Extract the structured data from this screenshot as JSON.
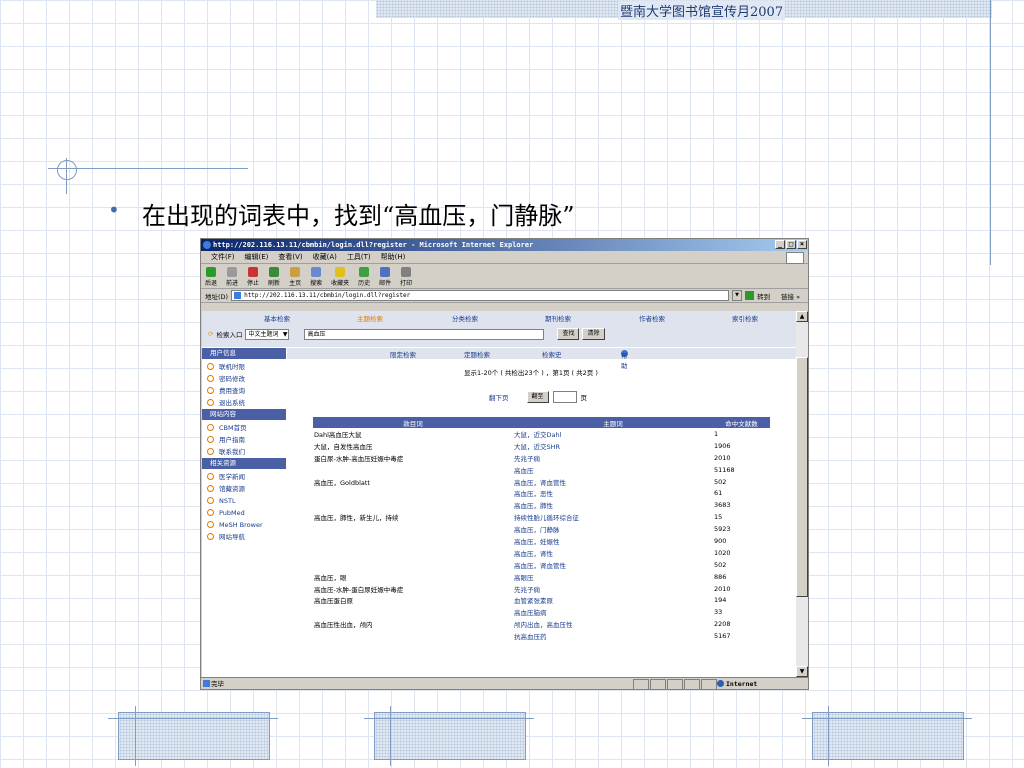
{
  "slide": {
    "header": "暨南大学图书馆宣传月2007",
    "bullet": "•",
    "heading": "在出现的词表中，找到“高血压，门静脉”"
  },
  "browser": {
    "title": "http://202.116.13.11/cbmbin/login.dll?register - Microsoft Internet Explorer",
    "controls": [
      "_",
      "□",
      "×"
    ],
    "menu": [
      "文件(F)",
      "编辑(E)",
      "查看(V)",
      "收藏(A)",
      "工具(T)",
      "帮助(H)"
    ],
    "toolbar": [
      {
        "label": "后退",
        "icon": "back-icon",
        "color": "#2a9a2a"
      },
      {
        "label": "前进",
        "icon": "forward-icon",
        "color": "#9a9a9a"
      },
      {
        "label": "停止",
        "icon": "stop-icon",
        "color": "#c83232"
      },
      {
        "label": "刷新",
        "icon": "refresh-icon",
        "color": "#3a8a3a"
      },
      {
        "label": "主页",
        "icon": "home-icon",
        "color": "#c8a040"
      },
      {
        "label": "搜索",
        "icon": "search-icon",
        "color": "#6a8ad0"
      },
      {
        "label": "收藏夹",
        "icon": "favorites-icon",
        "color": "#e0c020"
      },
      {
        "label": "历史",
        "icon": "history-icon",
        "color": "#40a040"
      },
      {
        "label": "邮件",
        "icon": "mail-icon",
        "color": "#5070c0"
      },
      {
        "label": "打印",
        "icon": "print-icon",
        "color": "#808080"
      }
    ],
    "address_label": "地址(D)",
    "address": "http://202.116.13.11/cbmbin/login.dll?register",
    "go_label": "转到",
    "links_label": "链接 »",
    "status": "完毕",
    "zone": "Internet"
  },
  "page": {
    "tabs": [
      "基本检索",
      "主题检索",
      "分类检索",
      "期刊检索",
      "作者检索",
      "索引检索"
    ],
    "active_tab": "主题检索",
    "search_entry_label": "检索入口",
    "search_entry_value": "中文主题词",
    "search_value": "高血压",
    "search_button": "查找",
    "clear_button": "清除",
    "sidebar": [
      {
        "heading": "用户信息",
        "items": [
          "联机时限",
          "密码修改",
          "费用查询",
          "退出系统"
        ]
      },
      {
        "heading": "网站内容",
        "items": [
          "CBM首页",
          "用户指南",
          "联系我们"
        ]
      },
      {
        "heading": "相关资源",
        "items": [
          "医学新闻",
          "馆藏资源",
          "NSTL",
          "PubMed",
          "MeSH Brower",
          "网站导航"
        ]
      }
    ],
    "toplinks": [
      "限定检索",
      "定题检索",
      "检索史",
      "帮助"
    ],
    "result_info": "显示1-20个 ( 共检出23个 ) ，第1页 ( 共2页 )",
    "pager": {
      "next": "翻下页",
      "goto": "翻至",
      "page_suffix": "页"
    },
    "table": {
      "headers": [
        "款目词",
        "主题词",
        "命中文献数"
      ],
      "rows": [
        [
          "Dahl高血压大鼠",
          "大鼠，近交Dahl",
          "1"
        ],
        [
          "大鼠，自发性高血压",
          "大鼠，近交SHR",
          "1906"
        ],
        [
          "蛋白尿-水肿-高血压妊娠中毒症",
          "先兆子痫",
          "2010"
        ],
        [
          "",
          "高血压",
          "51168"
        ],
        [
          "高血压，Goldblatt",
          "高血压，肾血管性",
          "502"
        ],
        [
          "",
          "高血压，恶性",
          "61"
        ],
        [
          "",
          "高血压，肺性",
          "3683"
        ],
        [
          "高血压，肺性，新生儿，持续",
          "持续性胎儿循环综合征",
          "15"
        ],
        [
          "",
          "高血压，门静脉",
          "5923"
        ],
        [
          "",
          "高血压，妊娠性",
          "900"
        ],
        [
          "",
          "高血压，肾性",
          "1020"
        ],
        [
          "",
          "高血压，肾血管性",
          "502"
        ],
        [
          "高血压，眼",
          "高眼压",
          "886"
        ],
        [
          "高血压-水肿-蛋白尿妊娠中毒症",
          "先兆子痫",
          "2010"
        ],
        [
          "高血压蛋白原",
          "血管紧张素原",
          "194"
        ],
        [
          "",
          "高血压脑病",
          "33"
        ],
        [
          "高血压性出血，颅内",
          "颅内出血，高血压性",
          "2208"
        ],
        [
          "",
          "抗高血压药",
          "5167"
        ]
      ]
    }
  }
}
